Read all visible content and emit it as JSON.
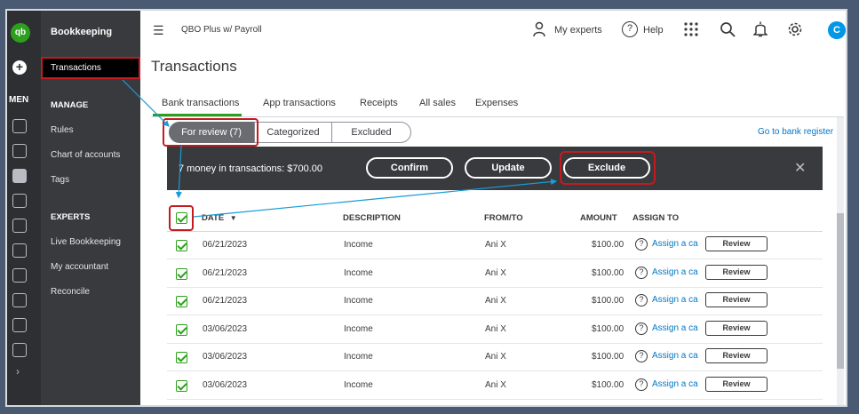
{
  "app": {
    "logo": "qb",
    "menu_label": "MEN",
    "company": "QBO Plus w/ Payroll",
    "avatar_initial": "C"
  },
  "sidebar": {
    "title": "Bookkeeping",
    "active_item": "Transactions",
    "manage_heading": "MANAGE",
    "manage_items": [
      "Rules",
      "Chart of accounts",
      "Tags"
    ],
    "experts_heading": "EXPERTS",
    "experts_items": [
      "Live Bookkeeping",
      "My accountant",
      "Reconcile"
    ]
  },
  "topbar": {
    "my_experts": "My experts",
    "help": "Help"
  },
  "page": {
    "title": "Transactions",
    "tabs": [
      "Bank transactions",
      "App transactions",
      "Receipts",
      "All sales",
      "Expenses"
    ],
    "segments": [
      "For review (7)",
      "Categorized",
      "Excluded"
    ],
    "bank_register_link": "Go to bank register"
  },
  "batch": {
    "summary": "7 money in transactions: $700.00",
    "confirm": "Confirm",
    "update": "Update",
    "exclude": "Exclude",
    "close": "✕"
  },
  "table": {
    "columns": {
      "date": "DATE",
      "sort": "▼",
      "description": "DESCRIPTION",
      "from_to": "FROM/TO",
      "amount": "AMOUNT",
      "assign_to": "ASSIGN TO"
    },
    "rows": [
      {
        "date": "06/21/2023",
        "description": "Income",
        "from_to": "Ani X",
        "amount": "$100.00",
        "assign": "Assign a ca",
        "action": "Review"
      },
      {
        "date": "06/21/2023",
        "description": "Income",
        "from_to": "Ani X",
        "amount": "$100.00",
        "assign": "Assign a ca",
        "action": "Review"
      },
      {
        "date": "06/21/2023",
        "description": "Income",
        "from_to": "Ani X",
        "amount": "$100.00",
        "assign": "Assign a ca",
        "action": "Review"
      },
      {
        "date": "03/06/2023",
        "description": "Income",
        "from_to": "Ani X",
        "amount": "$100.00",
        "assign": "Assign a ca",
        "action": "Review"
      },
      {
        "date": "03/06/2023",
        "description": "Income",
        "from_to": "Ani X",
        "amount": "$100.00",
        "assign": "Assign a ca",
        "action": "Review"
      },
      {
        "date": "03/06/2023",
        "description": "Income",
        "from_to": "Ani X",
        "amount": "$100.00",
        "assign": "Assign a ca",
        "action": "Review"
      }
    ]
  },
  "colors": {
    "brand_green": "#2ca01c",
    "sidebar": "#393a3d",
    "rail": "#2e2f32",
    "link": "#0077c5",
    "highlight": "#c41a20",
    "arrow": "#1a9bd7"
  }
}
